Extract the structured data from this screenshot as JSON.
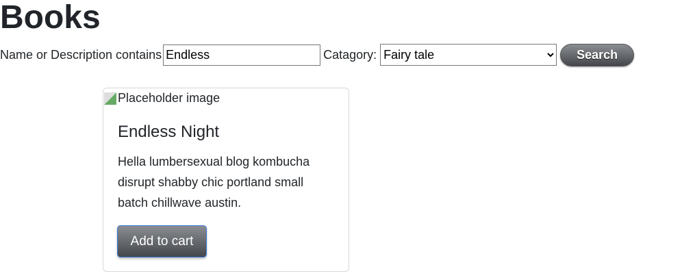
{
  "page": {
    "title": "Books"
  },
  "filter": {
    "name_label": "Name or Description contains",
    "name_value": "Endless",
    "category_label": "Catagory:",
    "category_selected": "Fairy tale",
    "search_label": "Search"
  },
  "products": [
    {
      "image_alt": "Placeholder image",
      "title": "Endless Night",
      "description": "Hella lumbersexual blog kombucha disrupt shabby chic portland small batch chillwave austin.",
      "button": "Add to cart"
    }
  ]
}
